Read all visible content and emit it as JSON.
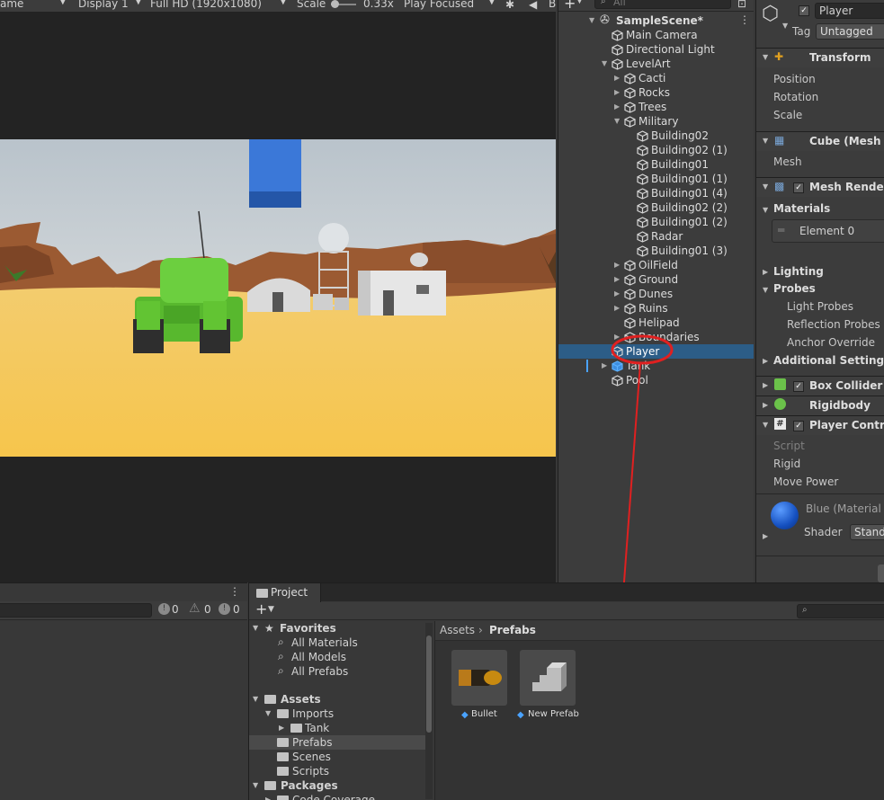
{
  "game_toolbar": {
    "view_mode": "ame",
    "display": "Display 1",
    "resolution": "Full HD (1920x1080)",
    "scale_label": "Scale",
    "scale_value": "0.33x",
    "play_mode": "Play Focused"
  },
  "hierarchy": {
    "search_placeholder": "All",
    "scene": "SampleScene*",
    "items": [
      {
        "label": "Main Camera"
      },
      {
        "label": "Directional Light"
      },
      {
        "label": "LevelArt"
      },
      {
        "label": "Cacti"
      },
      {
        "label": "Rocks"
      },
      {
        "label": "Trees"
      },
      {
        "label": "Military"
      },
      {
        "label": "Building02"
      },
      {
        "label": "Building02 (1)"
      },
      {
        "label": "Building01"
      },
      {
        "label": "Building01 (1)"
      },
      {
        "label": "Building01 (4)"
      },
      {
        "label": "Building02 (2)"
      },
      {
        "label": "Building01 (2)"
      },
      {
        "label": "Radar"
      },
      {
        "label": "Building01 (3)"
      },
      {
        "label": "OilField"
      },
      {
        "label": "Ground"
      },
      {
        "label": "Dunes"
      },
      {
        "label": "Ruins"
      },
      {
        "label": "Helipad"
      },
      {
        "label": "Boundaries"
      },
      {
        "label": "Player"
      },
      {
        "label": "Tank"
      },
      {
        "label": "Pool"
      }
    ]
  },
  "inspector": {
    "object_name": "Player",
    "tag_label": "Tag",
    "tag_value": "Untagged",
    "transform": {
      "title": "Transform",
      "position": "Position",
      "rotation": "Rotation",
      "scale": "Scale"
    },
    "mesh_filter": {
      "title": "Cube (Mesh Fi",
      "mesh": "Mesh"
    },
    "mesh_renderer": {
      "title": "Mesh Rendere",
      "materials": "Materials",
      "element0": "Element 0"
    },
    "lighting": "Lighting",
    "probes": "Probes",
    "light_probes": "Light Probes",
    "reflection_probes": "Reflection Probes",
    "anchor_override": "Anchor Override",
    "additional_settings": "Additional Settings",
    "box_collider": "Box Collider",
    "rigidbody": "Rigidbody",
    "player_controller": {
      "title": "Player Control",
      "script": "Script",
      "rigid": "Rigid",
      "move_power": "Move Power"
    },
    "material": {
      "name": "Blue (Material",
      "shader_label": "Shader",
      "shader_value": "Standa"
    }
  },
  "console": {
    "errors": "0",
    "warnings": "0",
    "infos": "0"
  },
  "project": {
    "tab": "Project",
    "favorites": "Favorites",
    "favorite_items": [
      "All Materials",
      "All Models",
      "All Prefabs"
    ],
    "assets": "Assets",
    "imports": "Imports",
    "tank": "Tank",
    "prefabs": "Prefabs",
    "scenes": "Scenes",
    "scripts": "Scripts",
    "packages": "Packages",
    "code_coverage": "Code Coverage",
    "breadcrumb_root": "Assets",
    "breadcrumb_current": "Prefabs",
    "assets_grid": [
      {
        "label": "Bullet"
      },
      {
        "label": "New Prefab"
      }
    ]
  },
  "colors": {
    "selection": "#2c5d87",
    "annotation": "#e02020",
    "panel": "#3c3c3c"
  }
}
